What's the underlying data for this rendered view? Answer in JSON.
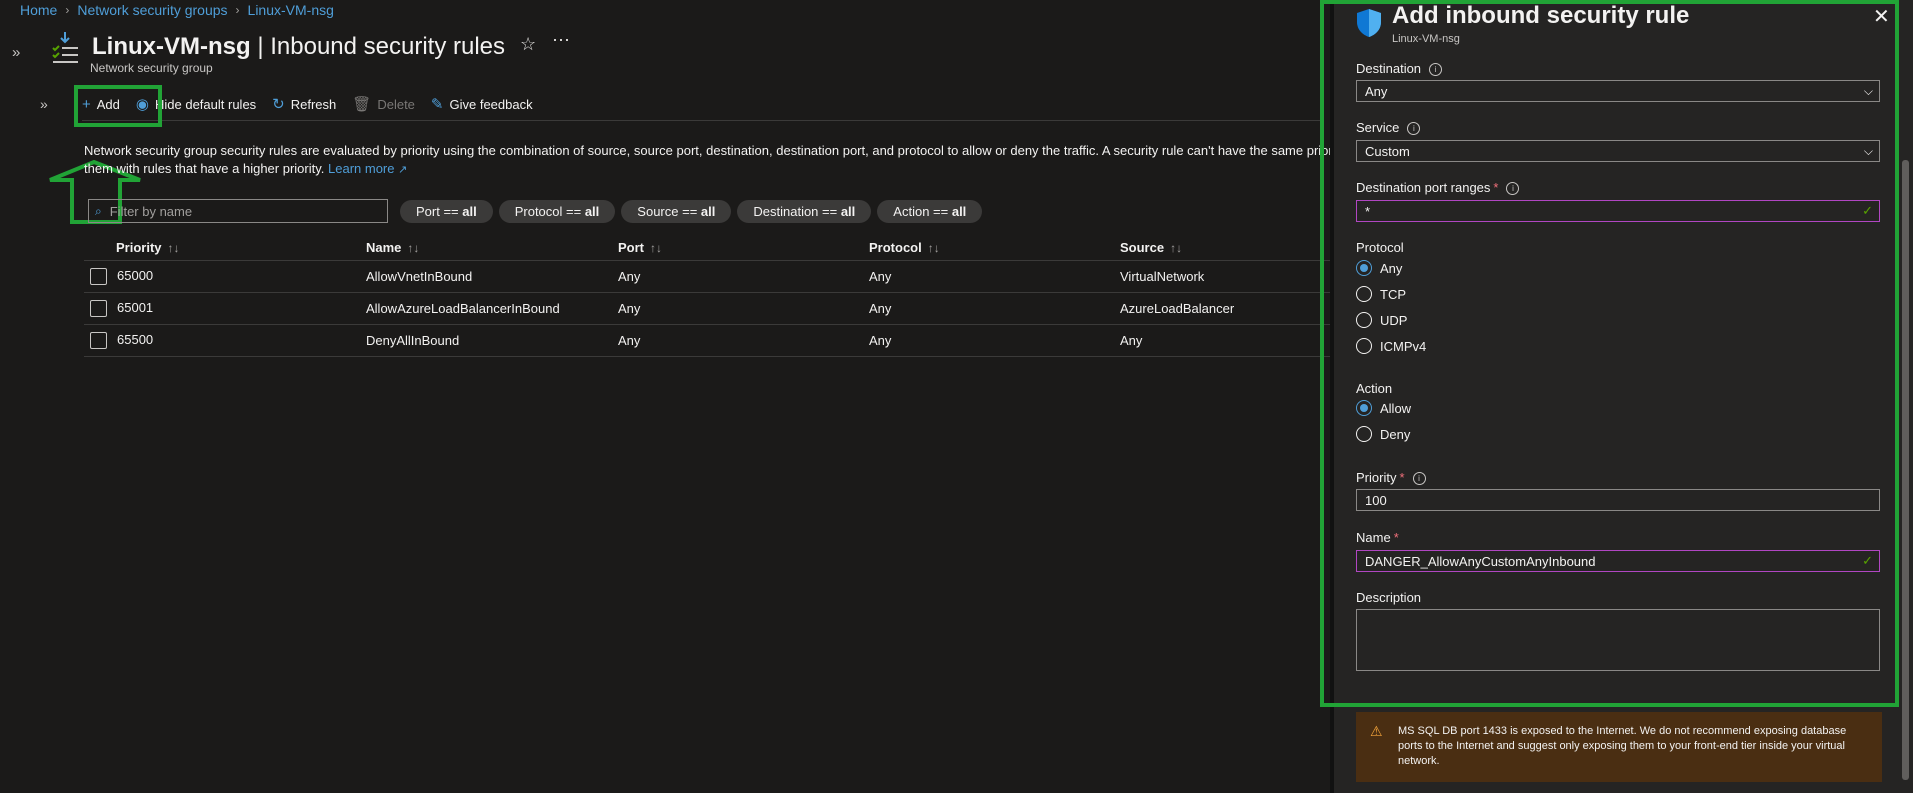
{
  "breadcrumb": {
    "items": [
      "Home",
      "Network security groups",
      "Linux-VM-nsg"
    ]
  },
  "header": {
    "resource_name": "Linux-VM-nsg",
    "page_name": "| Inbound security rules",
    "subtitle": "Network security group"
  },
  "toolbar": {
    "add_label": "Add",
    "hide_default_label": "Hide default rules",
    "refresh_label": "Refresh",
    "delete_label": "Delete",
    "feedback_label": "Give feedback"
  },
  "description": {
    "text": "Network security group security rules are evaluated by priority using the combination of source, source port, destination, destination port, and protocol to allow or deny the traffic. A security rule can't have the same priority",
    "text2": "them with rules that have a higher priority.",
    "learn_more": "Learn more"
  },
  "filters": {
    "search_placeholder": "Filter by name",
    "pills": [
      {
        "key": "Port == ",
        "value": "all"
      },
      {
        "key": "Protocol == ",
        "value": "all"
      },
      {
        "key": "Source == ",
        "value": "all"
      },
      {
        "key": "Destination == ",
        "value": "all"
      },
      {
        "key": "Action == ",
        "value": "all"
      }
    ]
  },
  "table": {
    "headers": [
      "Priority",
      "Name",
      "Port",
      "Protocol",
      "Source"
    ],
    "rows": [
      [
        "65000",
        "AllowVnetInBound",
        "Any",
        "Any",
        "VirtualNetwork"
      ],
      [
        "65001",
        "AllowAzureLoadBalancerInBound",
        "Any",
        "Any",
        "AzureLoadBalancer"
      ],
      [
        "65500",
        "DenyAllInBound",
        "Any",
        "Any",
        "Any"
      ]
    ]
  },
  "panel": {
    "title": "Add inbound security rule",
    "subtitle": "Linux-VM-nsg",
    "destination_label": "Destination",
    "destination_value": "Any",
    "service_label": "Service",
    "service_value": "Custom",
    "port_ranges_label": "Destination port ranges",
    "port_ranges_value": "*",
    "protocol_label": "Protocol",
    "protocol_options": [
      "Any",
      "TCP",
      "UDP",
      "ICMPv4"
    ],
    "protocol_selected": "Any",
    "action_label": "Action",
    "action_options": [
      "Allow",
      "Deny"
    ],
    "action_selected": "Allow",
    "priority_label": "Priority",
    "priority_value": "100",
    "name_label": "Name",
    "name_value": "DANGER_AllowAnyCustomAnyInbound",
    "description_label": "Description",
    "warning_text": "MS SQL DB port 1433 is exposed to the Internet. We do not recommend exposing database ports to the Internet and suggest only exposing them to your front-end tier inside your virtual network."
  },
  "colors": {
    "accent": "#4f9ed8",
    "highlight": "#21a336",
    "background": "#1b1a19",
    "panel": "#252423"
  }
}
